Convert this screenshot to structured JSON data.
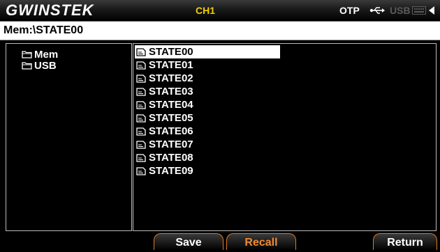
{
  "header": {
    "logo": "GWINSTEK",
    "channel": "CH1",
    "otp": "OTP",
    "usb_label": "USB",
    "icons": [
      "usb-connector-icon",
      "keyboard-icon",
      "left-arrow-icon"
    ]
  },
  "path": "Mem:\\STATE00",
  "tree": {
    "items": [
      {
        "label": "Mem",
        "icon": "folder-icon"
      },
      {
        "label": "USB",
        "icon": "folder-icon"
      }
    ]
  },
  "files": {
    "selected_index": 0,
    "items": [
      {
        "label": "STATE00",
        "icon": "file-icon"
      },
      {
        "label": "STATE01",
        "icon": "file-icon"
      },
      {
        "label": "STATE02",
        "icon": "file-icon"
      },
      {
        "label": "STATE03",
        "icon": "file-icon"
      },
      {
        "label": "STATE04",
        "icon": "file-icon"
      },
      {
        "label": "STATE05",
        "icon": "file-icon"
      },
      {
        "label": "STATE06",
        "icon": "file-icon"
      },
      {
        "label": "STATE07",
        "icon": "file-icon"
      },
      {
        "label": "STATE08",
        "icon": "file-icon"
      },
      {
        "label": "STATE09",
        "icon": "file-icon"
      }
    ]
  },
  "softkeys": {
    "save": "Save",
    "recall": "Recall",
    "return": "Return"
  },
  "colors": {
    "channel": "#f0d000",
    "softkey_border": "#e07a1f",
    "recall_text": "#f08a30",
    "usb_disabled": "#5a5a5a"
  }
}
